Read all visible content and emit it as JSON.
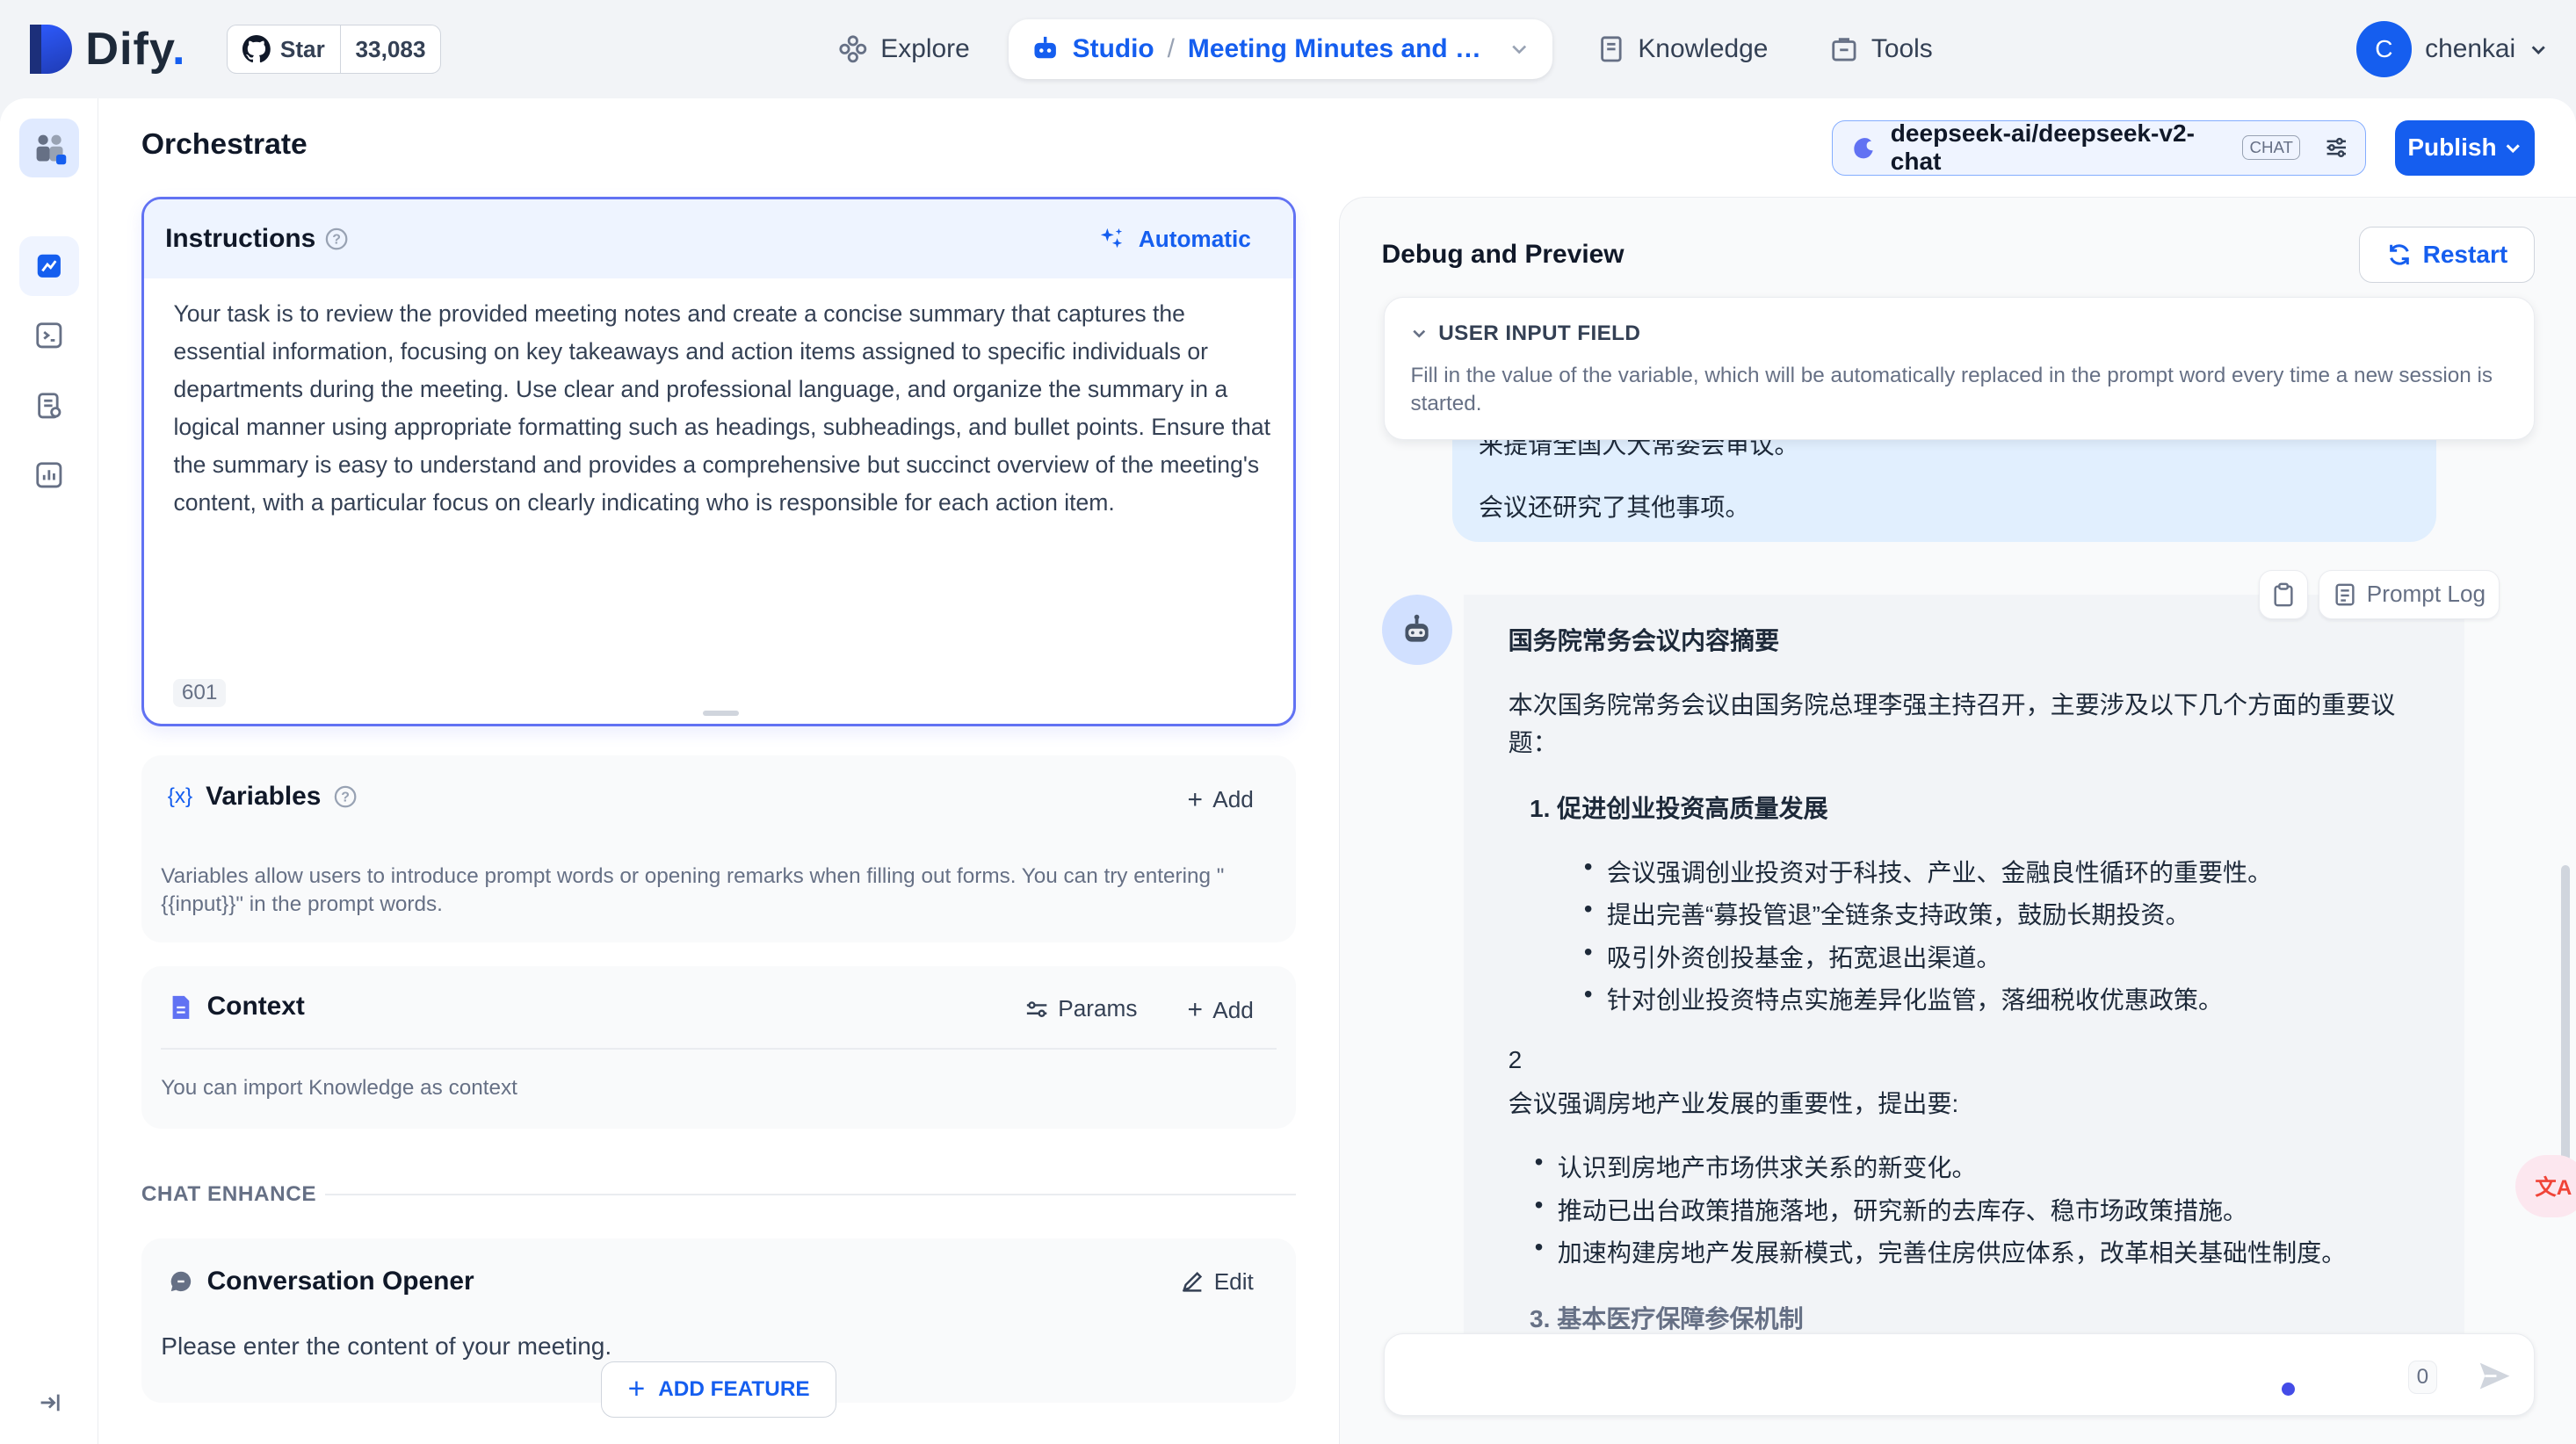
{
  "brand": {
    "logo_text": "Dify",
    "logo_suffix": "."
  },
  "github": {
    "star_label": "Star",
    "star_count": "33,083"
  },
  "nav": {
    "explore": "Explore",
    "studio": "Studio",
    "app_name": "Meeting Minutes and Su...",
    "knowledge": "Knowledge",
    "tools": "Tools"
  },
  "user": {
    "initial": "C",
    "name": "chenkai"
  },
  "page": {
    "title": "Orchestrate"
  },
  "model": {
    "name": "deepseek-ai/deepseek-v2-chat",
    "tag": "CHAT"
  },
  "publish": {
    "label": "Publish"
  },
  "instructions": {
    "title": "Instructions",
    "automatic_label": "Automatic",
    "text": "Your task is to review the provided meeting notes and create a concise summary that captures the essential information, focusing on key takeaways and action items assigned to specific individuals or departments during the meeting. Use clear and professional language, and organize the summary in a logical manner using appropriate formatting such as headings, subheadings, and bullet points. Ensure that the summary is easy to understand and provides a comprehensive but succinct overview of the meeting's content, with a particular focus on clearly indicating who is responsible for each action item.",
    "char_count": "601"
  },
  "variables": {
    "title": "Variables",
    "add_label": "Add",
    "description": "Variables allow users to introduce prompt words or opening remarks when filling out forms. You can try entering \"{{input}}\" in the prompt words."
  },
  "context": {
    "title": "Context",
    "params_label": "Params",
    "add_label": "Add",
    "description": "You can import Knowledge as context"
  },
  "chat_enhance": {
    "label": "CHAT ENHANCE"
  },
  "conversation_opener": {
    "title": "Conversation Opener",
    "edit_label": "Edit",
    "text": "Please enter the content of your meeting."
  },
  "add_feature": {
    "label": "ADD FEATURE"
  },
  "debug": {
    "title": "Debug and Preview",
    "restart_label": "Restart",
    "user_input_field": {
      "title": "USER INPUT FIELD",
      "description": "Fill in the value of the variable, which will be automatically replaced in the prompt word every time a new session is started."
    }
  },
  "messages": {
    "user_partial": "来提请全国人大常委会审议。",
    "user_last": "会议还研究了其他事项。",
    "prompt_log_label": "Prompt Log",
    "bot": {
      "heading": "国务院常务会议内容摘要",
      "intro_line1": "本次国务院常务会议由国务院总理李强主持召开，主要涉及以下几个方面的重要议",
      "intro_line2": "题：",
      "section1_title": "1. 促进创业投资高质量发展",
      "section1_items": [
        "会议强调创业投资对于科技、产业、金融良性循环的重要性。",
        "提出完善“募投管退”全链条支持政策，鼓励长期投资。",
        "吸引外资创投基金，拓宽退出渠道。",
        "针对创业投资特点实施差异化监管，落细税收优惠政策。"
      ],
      "section2_number": "2",
      "section2_title": "会议强调房地产业发展的重要性，提出要:",
      "section2_items": [
        "认识到房地产市场供求关系的新变化。",
        "推动已出台政策措施落地，研究新的去库存、稳市场政策措施。",
        "加速构建房地产发展新模式，完善住房供应体系，改革相关基础性制度。"
      ],
      "section3_title": "3. 基本医疗保障参保机制"
    }
  },
  "chat_input": {
    "counter": "0"
  }
}
